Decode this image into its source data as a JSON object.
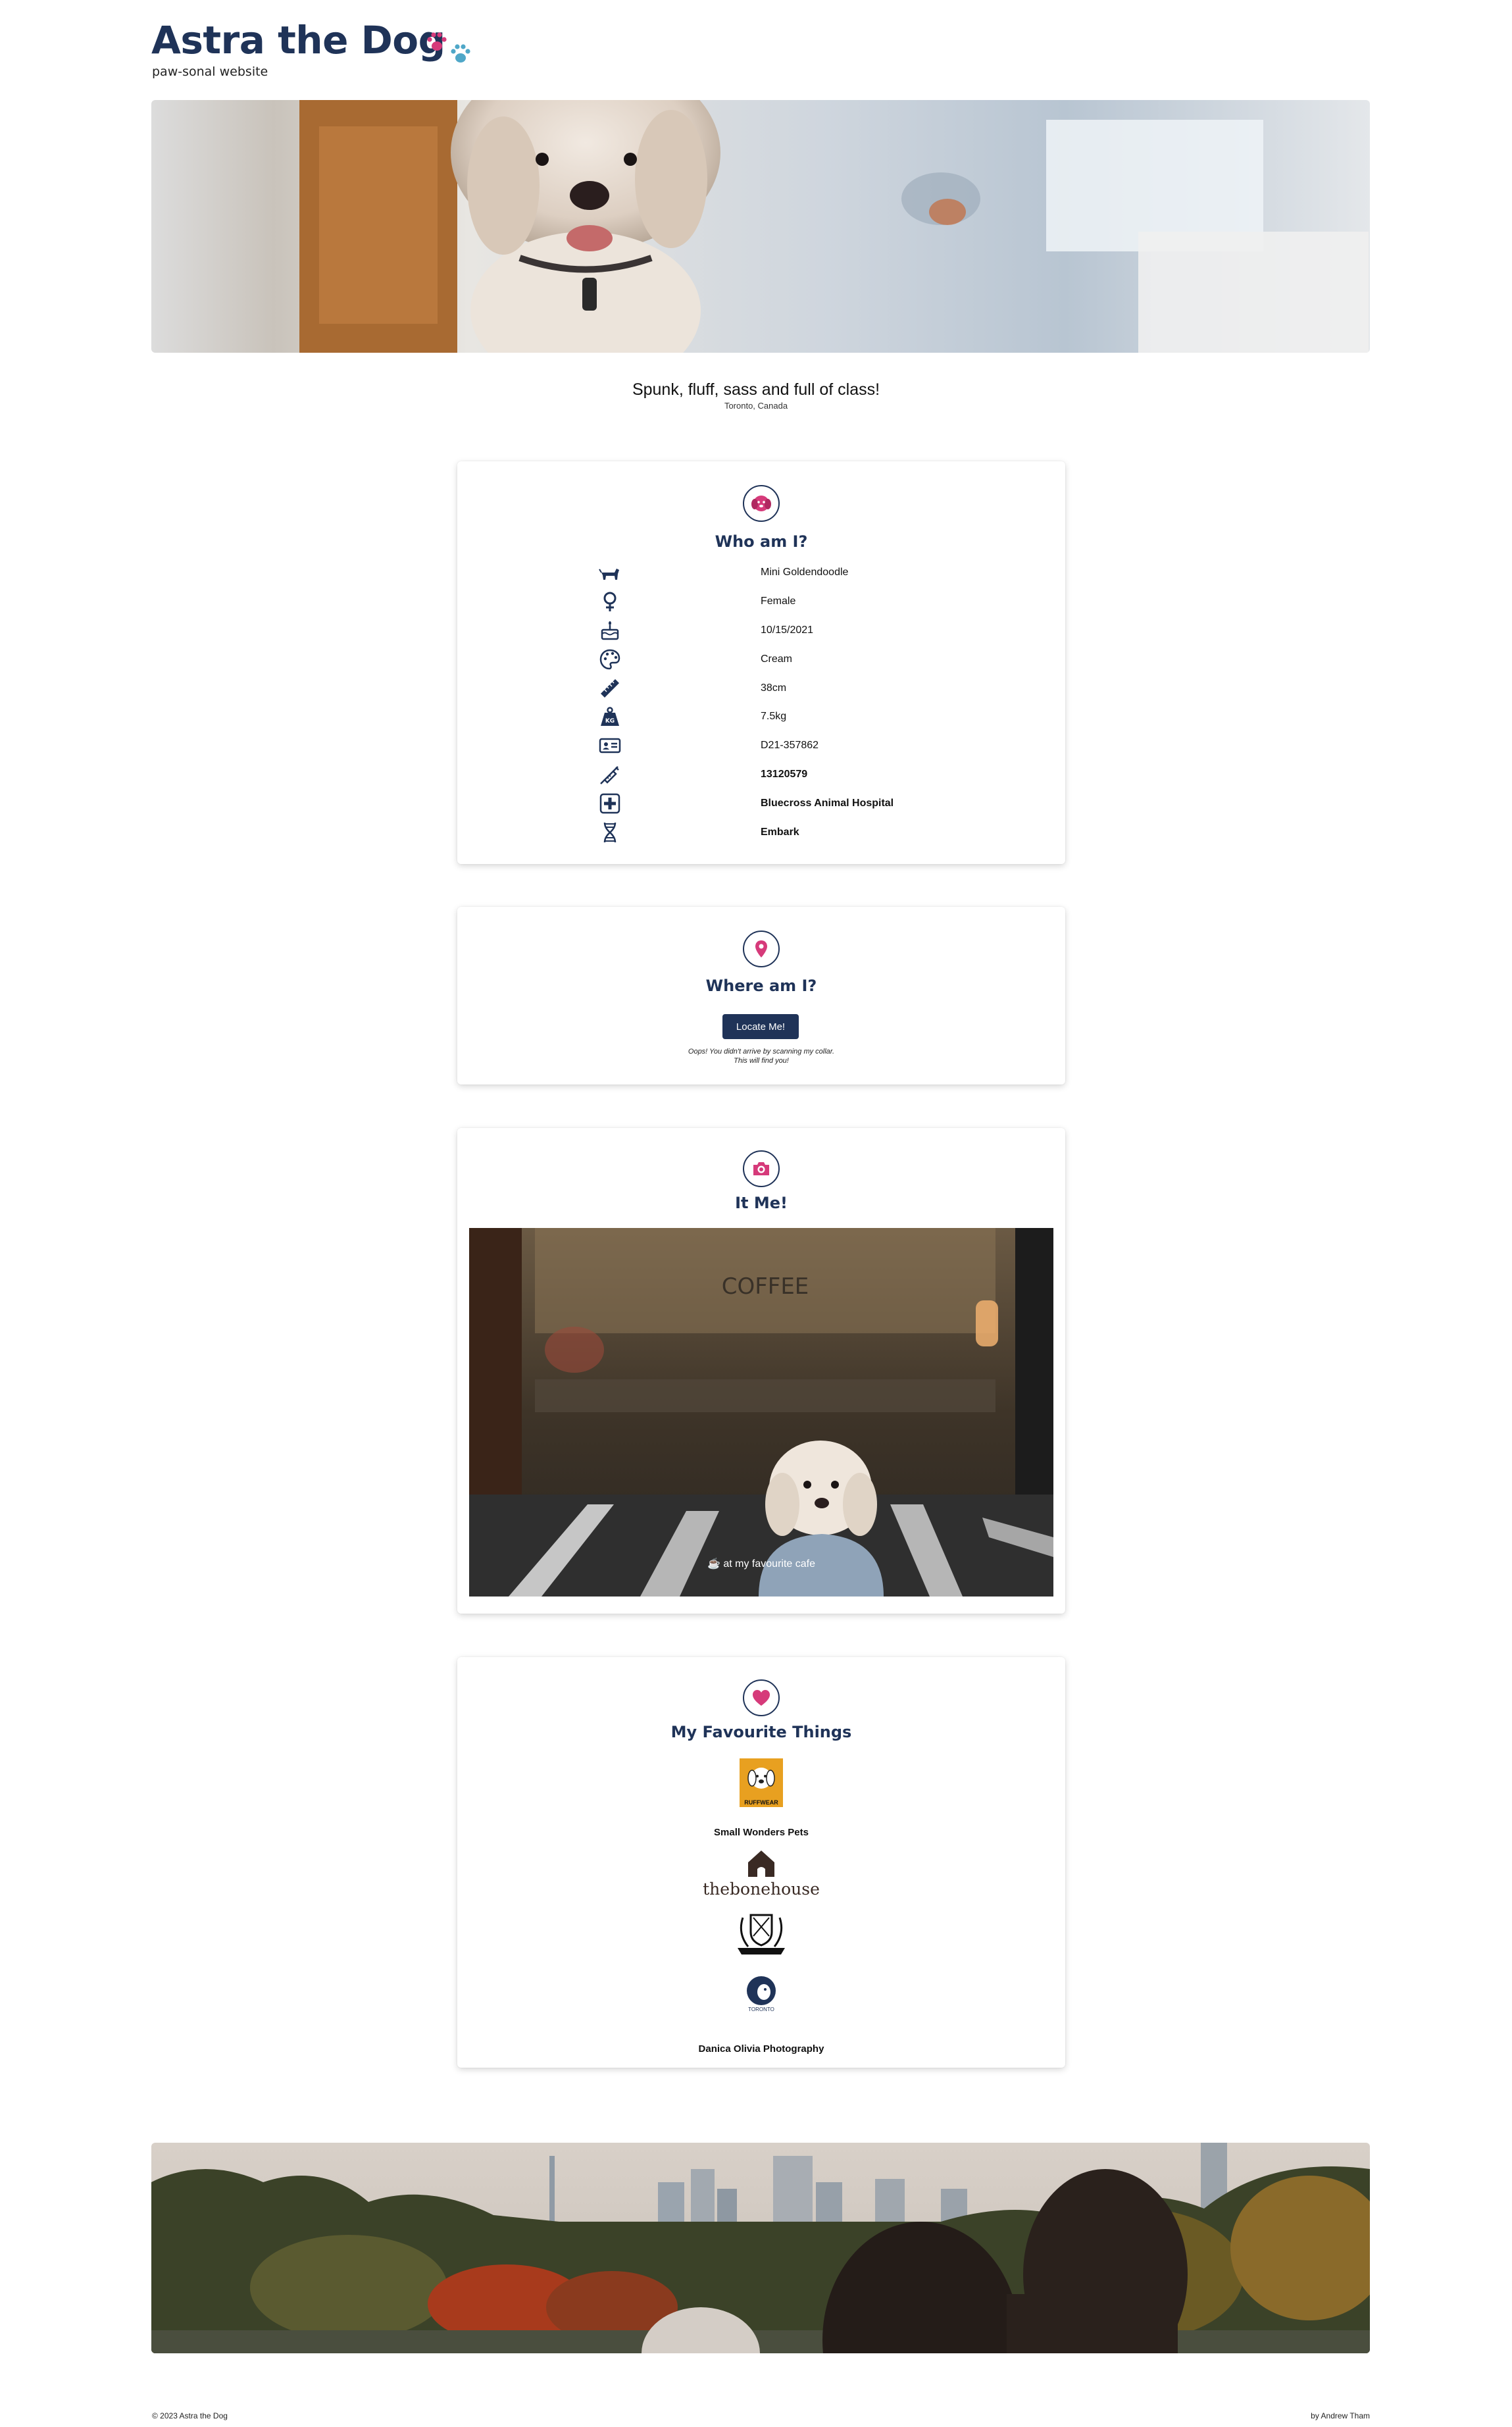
{
  "header": {
    "title": "Astra the Dog",
    "tagline": "paw-sonal website"
  },
  "intro": {
    "motto": "Spunk, fluff, sass and full of class!",
    "location": "Toronto, Canada"
  },
  "who": {
    "title": "Who am I?",
    "rows": [
      {
        "icon": "dog-icon",
        "value": "Mini Goldendoodle"
      },
      {
        "icon": "female-icon",
        "value": "Female"
      },
      {
        "icon": "birthday-cake-icon",
        "value": "10/15/2021"
      },
      {
        "icon": "palette-icon",
        "value": "Cream"
      },
      {
        "icon": "ruler-icon",
        "value": "38cm"
      },
      {
        "icon": "weight-icon",
        "value": "7.5kg"
      },
      {
        "icon": "id-card-icon",
        "value": "D21-357862"
      },
      {
        "icon": "syringe-icon",
        "value": "13120579"
      },
      {
        "icon": "medical-cross-icon",
        "value": "Bluecross Animal Hospital"
      },
      {
        "icon": "dna-icon",
        "value": "Embark"
      }
    ]
  },
  "where": {
    "title": "Where am I?",
    "button": "Locate Me!",
    "note_line1": "Oops! You didn't arrive by scanning my collar.",
    "note_line2": "This will find you!"
  },
  "photo": {
    "title": "It Me!",
    "caption": "☕ at my favourite cafe"
  },
  "favourites": {
    "title": "My Favourite Things",
    "items": [
      {
        "logo": "ruffwear-logo",
        "logo_text": "RUFFWEAR",
        "name": "Small Wonders Pets"
      },
      {
        "logo": "thebonehouse-logo",
        "logo_text": "thebonehouse",
        "name": ""
      },
      {
        "logo": "crest-logo",
        "logo_text": "",
        "name": ""
      },
      {
        "logo": "dog-cafe-logo",
        "logo_text": "TORONTO",
        "name": "Danica Olivia Photography"
      }
    ]
  },
  "footer": {
    "copyright": "© 2023 Astra the Dog",
    "byline": "by Andrew Tham"
  },
  "colors": {
    "navy": "#1f3358",
    "pink": "#d63a7a",
    "teal": "#4fa7c8"
  }
}
